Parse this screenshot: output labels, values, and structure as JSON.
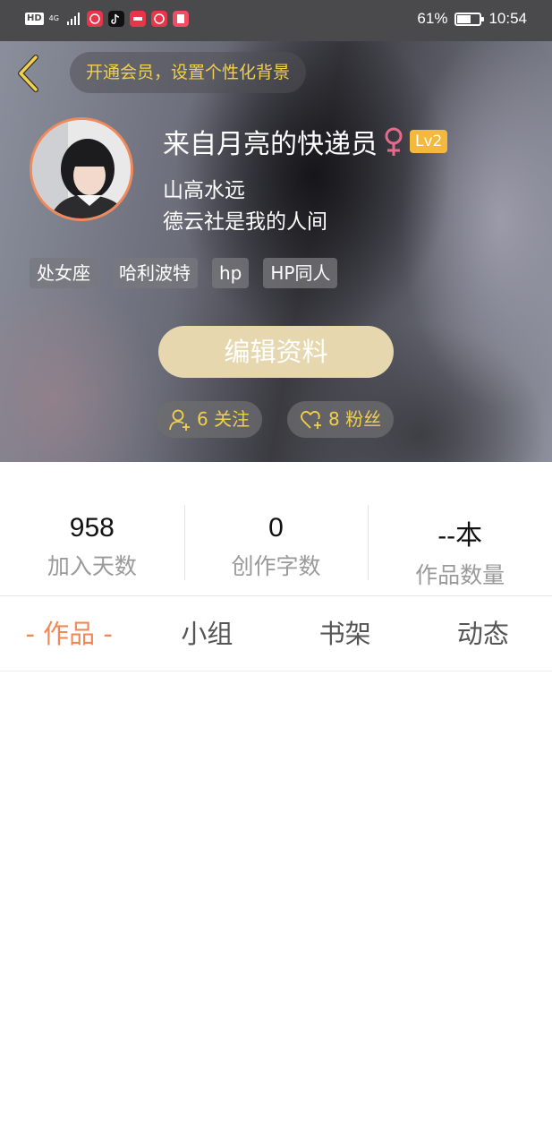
{
  "status_bar": {
    "signal_label": "4G",
    "battery": "61%",
    "battery_level": 0.61,
    "time": "10:54"
  },
  "header": {
    "back_icon": "chevron-left-icon",
    "vip_text": "开通会员，设置个性化背景",
    "username": "来自月亮的快递员",
    "gender_symbol": "♀",
    "level": "Lv2",
    "bio_line1": "山高水远",
    "bio_line2": "德云社是我的人间",
    "tags": [
      "处女座",
      "哈利波特",
      "hp",
      "HP同人"
    ],
    "edit_button": "编辑资料",
    "following": "6 关注",
    "followers": "8 粉丝"
  },
  "stats": [
    {
      "value": "958",
      "label": "加入天数"
    },
    {
      "value": "0",
      "label": "创作字数"
    },
    {
      "value": "--本",
      "label": "作品数量"
    }
  ],
  "tabs": [
    {
      "label": "- 作品 -",
      "active": true
    },
    {
      "label": "小组",
      "active": false
    },
    {
      "label": "书架",
      "active": false
    },
    {
      "label": "动态",
      "active": false
    }
  ],
  "colors": {
    "accent_orange": "#ef8a54",
    "vip_yellow": "#f2d04a",
    "edit_button_bg": "#e6d7ae",
    "level_badge": "#f3b93a",
    "female_symbol": "#e86a8a"
  }
}
